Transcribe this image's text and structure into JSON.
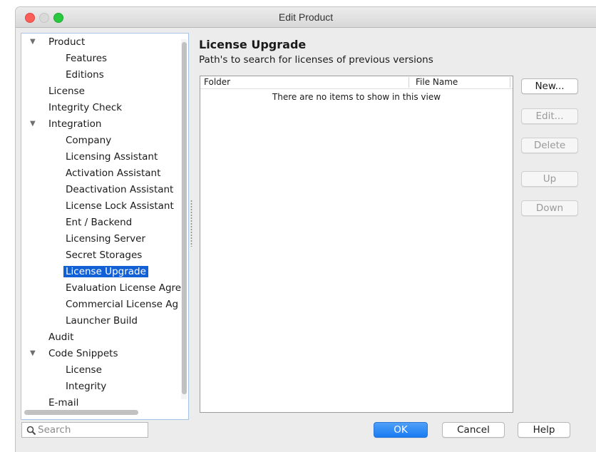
{
  "window": {
    "title": "Edit Product"
  },
  "tree": {
    "items": [
      {
        "label": "Product",
        "expanded": true
      },
      {
        "label": "Features"
      },
      {
        "label": "Editions"
      },
      {
        "label": "License"
      },
      {
        "label": "Integrity Check"
      },
      {
        "label": "Integration",
        "expanded": true
      },
      {
        "label": "Company"
      },
      {
        "label": "Licensing Assistant"
      },
      {
        "label": "Activation Assistant"
      },
      {
        "label": "Deactivation Assistant"
      },
      {
        "label": "License Lock Assistant"
      },
      {
        "label": "Ent / Backend"
      },
      {
        "label": "Licensing Server"
      },
      {
        "label": "Secret Storages"
      },
      {
        "label": "License Upgrade",
        "selected": true
      },
      {
        "label": "Evaluation License Agre"
      },
      {
        "label": "Commercial License Ag"
      },
      {
        "label": "Launcher Build"
      },
      {
        "label": "Audit"
      },
      {
        "label": "Code Snippets",
        "expanded": true
      },
      {
        "label": "License"
      },
      {
        "label": "Integrity"
      },
      {
        "label": "E-mail"
      }
    ]
  },
  "panel": {
    "title": "License Upgrade",
    "subtitle": "Path's to search for licenses of previous versions",
    "table": {
      "columns": [
        "Folder",
        "File Name"
      ],
      "empty_text": "There are no items to show in this view"
    },
    "side_buttons": {
      "new": "New...",
      "edit": "Edit...",
      "delete": "Delete",
      "up": "Up",
      "down": "Down"
    }
  },
  "footer": {
    "search_placeholder": "Search",
    "ok": "OK",
    "cancel": "Cancel",
    "help": "Help"
  }
}
